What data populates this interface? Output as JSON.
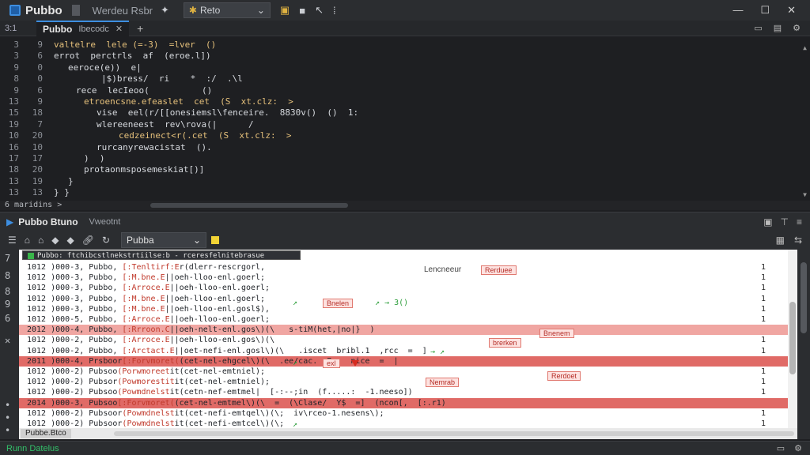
{
  "titlebar": {
    "app_name": "Pubbo",
    "project": "Werdeu Rsbr",
    "run_config": "Reto",
    "window_controls": [
      "—",
      "☐",
      "✕"
    ]
  },
  "tabs": {
    "line_col": "3:1",
    "tab_name": "Pubbo",
    "tab_file": "Ibecodc",
    "close": "✕",
    "plus": "+"
  },
  "editor": {
    "lines": [
      {
        "a": "3",
        "b": "9",
        "indent": 68,
        "code": "valtelre  lele (=-3)  =lver  ()",
        "cls": "yl"
      },
      {
        "a": "3",
        "b": "6",
        "indent": 68,
        "code": "errot  perctrls  af  (eroe.l])",
        "cls": ""
      },
      {
        "a": "9",
        "b": "0",
        "indent": 86,
        "code": "eeroce(e))  e|",
        "cls": ""
      },
      {
        "a": "8",
        "b": "0",
        "indent": 128,
        "code": "|$)bress/  ri    *  :/  .\\l",
        "cls": ""
      },
      {
        "a": "9",
        "b": "6",
        "indent": 96,
        "code": "rece  lecIeoo(          ()",
        "cls": ""
      },
      {
        "a": "13",
        "b": "9",
        "indent": 106,
        "code": "etroencsne.efeaslet  cet  (S  xt.clz:  >",
        "cls": "yl"
      },
      {
        "a": "15",
        "b": "18",
        "indent": 122,
        "code": "vise  eel(r/[[onesiemsl\\fenceire.  8830v()  ()  1:",
        "cls": ""
      },
      {
        "a": "19",
        "b": "7",
        "indent": 122,
        "code": "wlereeneest  rev\\rova(|      /",
        "cls": ""
      },
      {
        "a": "10",
        "b": "20",
        "indent": 150,
        "code": "cedzeinect<r(.cet  (S  xt.clz:  >",
        "cls": "yl"
      },
      {
        "a": "16",
        "b": "10",
        "indent": 122,
        "code": "rurcanyrewacistat  ().",
        "cls": ""
      },
      {
        "a": "17",
        "b": "17",
        "indent": 106,
        "code": ")  )",
        "cls": ""
      },
      {
        "a": "18",
        "b": "20",
        "indent": 106,
        "code": "protaonmsposemeskiat[)]",
        "cls": ""
      },
      {
        "a": "13",
        "b": "19",
        "indent": 86,
        "code": "}",
        "cls": ""
      },
      {
        "a": "13",
        "b": "13",
        "indent": 68,
        "code": "} }",
        "cls": ""
      }
    ],
    "hscroll_label": "6 maridins",
    "hscroll_arrow": ">"
  },
  "run_panel": {
    "title": "Pubbo Btuno",
    "tab2": "Vweotnt",
    "dropdown": "Pubba",
    "console_header": "Pubbo: ftchibcstlnekstrtiilse:b  -  rceresfelnitebrasue",
    "rows": [
      {
        "t": "1012 )000-3, Pubbo, ",
        "r": "[:Tenltirf:E",
        "e": "r(dlerr-rescrgorl,",
        "c": "1",
        "s": ""
      },
      {
        "t": "1012 )000-3, Pubbo, ",
        "r": "[:M.bne.E",
        "e": "||oeh-lloo-enl.goerl;",
        "c": "1",
        "s": ""
      },
      {
        "t": "1012 )000-3, Pubbo, ",
        "r": "[:Arroce.E",
        "e": "||oeh-lloo-enl.goerl;",
        "c": "1",
        "s": ""
      },
      {
        "t": "1012 )000-3, Pubbo, ",
        "r": "[:M.bne.E",
        "e": "||oeh-lloo-enl.goerl;",
        "c": "1",
        "s": ""
      },
      {
        "t": "1012 )000-3, Pubbo, ",
        "r": "[:M.bne.E",
        "e": "||oeh-lloo-enl.gosl$),",
        "c": "1",
        "s": ""
      },
      {
        "t": "1012 )000-5, Pubbo, ",
        "r": "[:Arroce.E",
        "e": "||oeh-lloo-enl.goerl;",
        "c": "1",
        "s": ""
      },
      {
        "t": "2012 )000-4, Pubbo, ",
        "r": "[:Rrroon.C",
        "e": "||oeh-nelt-enl.gos\\)(\\   s-tiM(het,|no|}  )",
        "c": "",
        "s": "err2"
      },
      {
        "t": "1012 )000-2, Pubbo, ",
        "r": "[:Arroce.E",
        "e": "||oeh-lloo-enl.gos\\)(\\",
        "c": "1",
        "s": ""
      },
      {
        "t": "1012 )000-2, Pubbo, ",
        "r": "[:Arctact.E",
        "e": "||oet-nefi-enl.gosl\\)(\\   .iscet  bribl.1  ,rcc  =  ]",
        "c": "1",
        "s": ""
      },
      {
        "t": "2011 )000-4, Prsboor",
        "r": "[:Forvmoret(",
        "e": "(cet-nel-ehgcel\\)(\\  .ee/cac.  7.   nice  =  |",
        "c": "",
        "s": "err"
      },
      {
        "t": "1012 )000-2) Pubsoo",
        "r": "(Porwmoreet",
        "e": "it(cet-nel-emtniel);",
        "c": "1",
        "s": ""
      },
      {
        "t": "1012 )000-2) Pubsor",
        "r": "(Powmorestit",
        "e": "it(cet-nel-emtniel);",
        "c": "1",
        "s": ""
      },
      {
        "t": "1012 )000-2) Pubsoo",
        "r": "(Powmdnelst",
        "e": "it(cetn-nef-emtmel|  [-:--;in  (f.....:  -1.neeso])",
        "c": "1",
        "s": ""
      },
      {
        "t": "2014 )000-3, Pubsoo",
        "r": "[:Forvmoret(",
        "e": "(cet-nel-emtmel\\)(\\  =  (\\Clase/  Y$  =]  (ncon[,  [:.r1)",
        "c": "",
        "s": "err"
      },
      {
        "t": "1012 )000-2) Pubsoor",
        "r": "(Powmdnelst",
        "e": "it(cet-nefi-emtqel\\)(\\;  iv\\rceo-1.nesens\\);",
        "c": "1",
        "s": ""
      },
      {
        "t": "1012 )000-2) Pubsoor",
        "r": "(Powmdnelst",
        "e": "it(cet-nefi-emtcel\\)(\\;",
        "c": "1",
        "s": ""
      }
    ],
    "tags": {
      "t1": "Lencneeur",
      "t2": "Rerduee",
      "t3": "Bnelen",
      "t4": "Bnenem",
      "t5": "brerken",
      "t6": "exl",
      "t7": "Nemrab",
      "t8": "Rerdoet"
    },
    "filter_chip": "Pubbe.Btco"
  },
  "statusbar": {
    "text": "Runn Datelus"
  },
  "colors": {
    "accent": "#3d8ee0",
    "error_row": "#e06a66",
    "ok_green": "#33c06a"
  }
}
